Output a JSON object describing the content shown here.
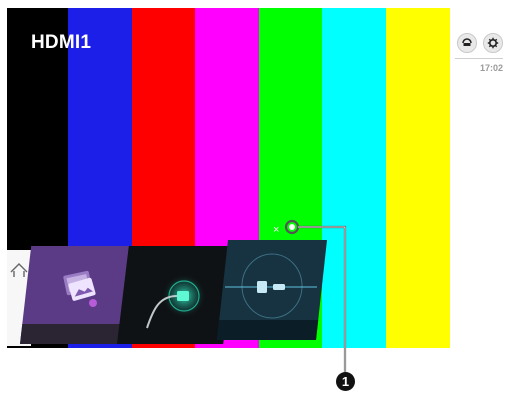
{
  "screen": {
    "source_title": "HDMI1",
    "color_bars": [
      "#000000",
      "#1b1fe8",
      "#ff0000",
      "#ff00ff",
      "#00ff00",
      "#00ffff",
      "#ffff00"
    ]
  },
  "popup": {
    "close_label": "×"
  },
  "launcher": {
    "cards": [
      {
        "icon": "photo-video-app-icon",
        "color": "#5b3b85"
      },
      {
        "icon": "hdmi-input-icon",
        "color": "#0f1214"
      },
      {
        "icon": "connection-device-icon",
        "color": "#173240"
      }
    ],
    "home_icon": "home-icon"
  },
  "status": {
    "clock": "17:02",
    "icons": [
      "input-icon",
      "settings-icon"
    ]
  },
  "annotation": {
    "marker": "1"
  }
}
